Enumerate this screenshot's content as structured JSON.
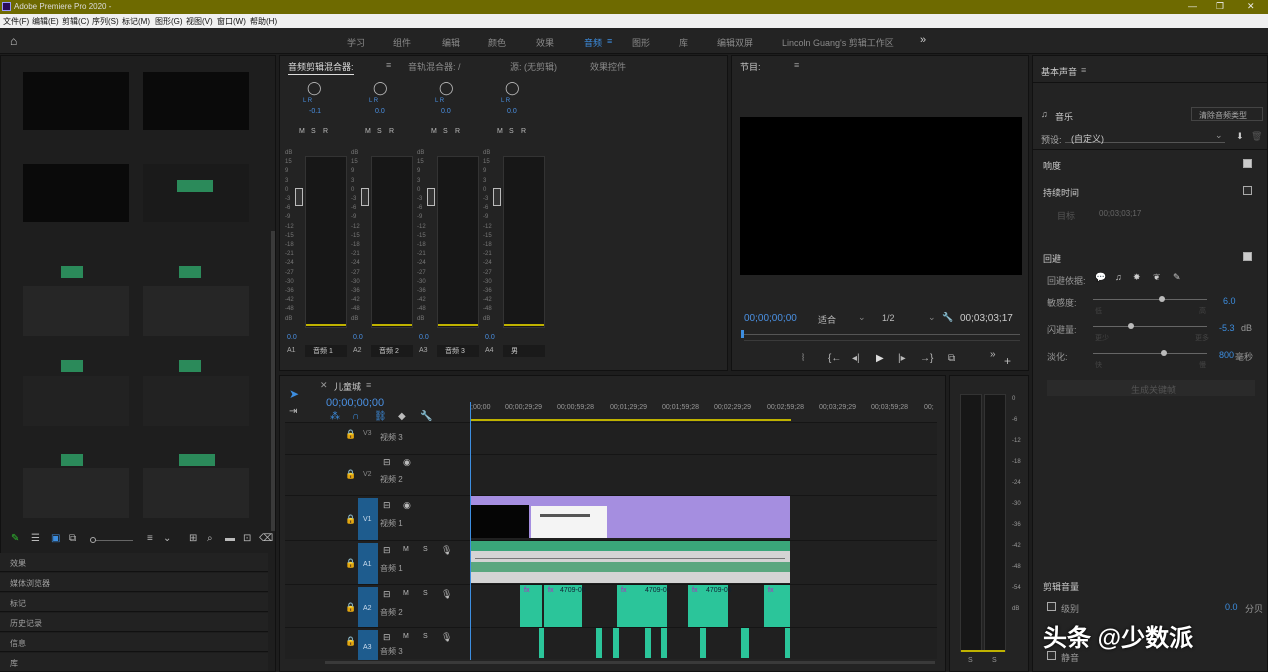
{
  "titlebar": {
    "title": "Adobe Premiere Pro 2020 - "
  },
  "menu": [
    "文件(F)",
    "编辑(E)",
    "剪辑(C)",
    "序列(S)",
    "标记(M)",
    "图形(G)",
    "视图(V)",
    "窗口(W)",
    "帮助(H)"
  ],
  "workspaces": [
    "学习",
    "组件",
    "编辑",
    "颜色",
    "效果",
    "音频",
    "图形",
    "库",
    "编辑双屏",
    "Lincoln Guang's 剪辑工作区"
  ],
  "mixer": {
    "tabs": [
      "音频剪辑混合器:",
      "音轨混合器: /",
      "源: (无剪辑)",
      "效果控件"
    ],
    "channels": [
      {
        "id": "A1",
        "name": "音频 1",
        "val": "-0.1",
        "lr": "L  R"
      },
      {
        "id": "A2",
        "name": "音频 2",
        "val": "0.0",
        "lr": "L  R"
      },
      {
        "id": "A3",
        "name": "音频 3",
        "val": "0.0",
        "lr": "L  R"
      },
      {
        "id": "A4",
        "name": "男",
        "val": "0.0",
        "lr": "L  R"
      }
    ],
    "scale": [
      "dB",
      "15",
      "9",
      "3",
      "0",
      "-3",
      "-6",
      "-9",
      "-12",
      "-15",
      "-18",
      "-21",
      "-24",
      "-27",
      "-30",
      "-36",
      "-42",
      "-48",
      "dB"
    ],
    "msr": [
      "M",
      "S",
      "R"
    ]
  },
  "program": {
    "title": "节目:",
    "timecode": "00;00;00;00",
    "fit": "适合",
    "res": "1/2",
    "duration": "00;03;03;17"
  },
  "timeline": {
    "seq_name": "儿童城",
    "timecode": "00;00;00;00",
    "ruler": [
      ";00;00",
      "00;00;29;29",
      "00;00;59;28",
      "00;01;29;29",
      "00;01;59;28",
      "00;02;29;29",
      "00;02;59;28",
      "00;03;29;29",
      "00;03;59;28",
      "00;"
    ],
    "tracks": [
      {
        "id": "V3",
        "name": "视频 3"
      },
      {
        "id": "V2",
        "name": "视频 2"
      },
      {
        "id": "V1",
        "name": "视频 1"
      },
      {
        "id": "A1",
        "name": "音频 1"
      },
      {
        "id": "A2",
        "name": "音频 2"
      },
      {
        "id": "A3",
        "name": "音频 3"
      }
    ],
    "clip_labels": [
      "fx",
      "4709-09",
      "fx",
      "fx",
      "4709-09",
      "fx",
      "4709-09",
      "fx"
    ]
  },
  "meters_scale": [
    "0",
    "-6",
    "-12",
    "-18",
    "-24",
    "-30",
    "-36",
    "-42",
    "-48",
    "-54",
    "dB"
  ],
  "meters_bottom": [
    "S",
    "S"
  ],
  "project_panels": [
    "效果",
    "媒体浏览器",
    "标记",
    "历史记录",
    "信息",
    "库"
  ],
  "essential_sound": {
    "title": "基本声音",
    "type": "音乐",
    "clear": "清除音频类型",
    "preset_label": "预设:",
    "preset": "(自定义)",
    "loudness": "响度",
    "duration": "持续时间",
    "target": "目标",
    "target_val": "00;03;03;17",
    "ducking": "回避",
    "duck_against": "回避依据:",
    "sensitivity": "敏感度:",
    "sens_val": "6.0",
    "sens_lo": "低",
    "sens_hi": "高",
    "duck_amount": "闪避量:",
    "amount_val": "-5.3",
    "amount_unit": "dB",
    "amt_lo": "更少",
    "amt_hi": "更多",
    "fade": "淡化:",
    "fade_val": "800",
    "fade_unit": "毫秒",
    "fade_lo": "快",
    "fade_hi": "慢",
    "generate": "生成关键帧",
    "clip_volume": "剪辑音量",
    "level": "级别",
    "level_val": "0.0",
    "level_unit": "分贝",
    "mute": "静音"
  },
  "watermark": "头条 @少数派"
}
